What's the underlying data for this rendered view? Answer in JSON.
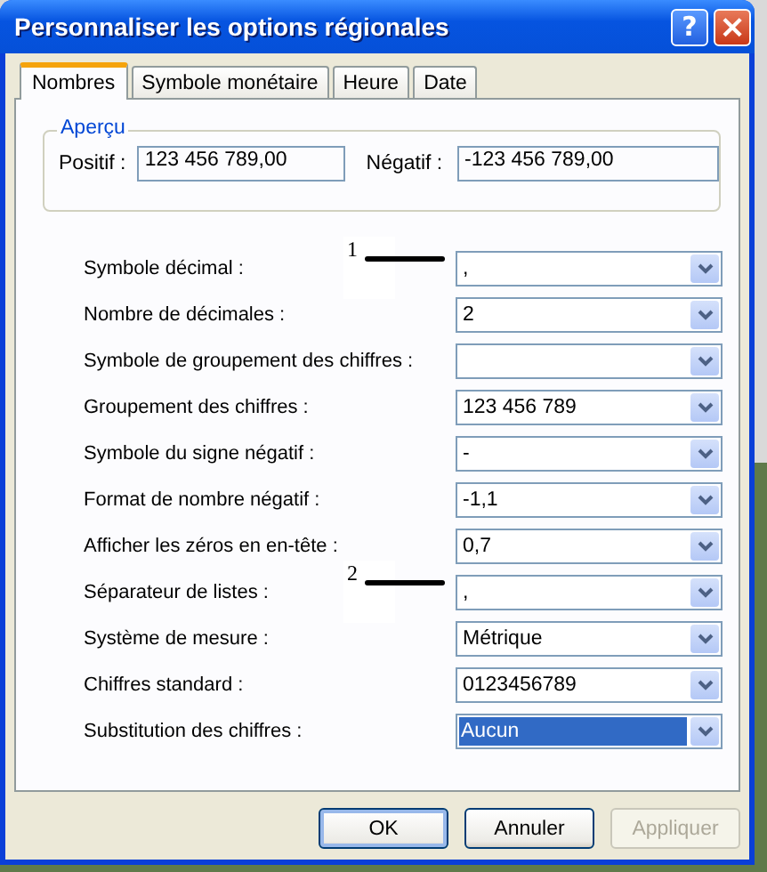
{
  "window": {
    "title": "Personnaliser les options régionales",
    "help": "?",
    "close": "×"
  },
  "tabs": [
    {
      "label": "Nombres",
      "selected": true
    },
    {
      "label": "Symbole monétaire",
      "selected": false
    },
    {
      "label": "Heure",
      "selected": false
    },
    {
      "label": "Date",
      "selected": false
    }
  ],
  "preview": {
    "title": "Aperçu",
    "positive_label": "Positif :",
    "positive_value": "123 456 789,00",
    "negative_label": "Négatif :",
    "negative_value": "-123 456 789,00"
  },
  "settings": [
    {
      "label": "Symbole décimal :",
      "value": ",",
      "focused": false,
      "annotation": "1"
    },
    {
      "label": "Nombre de décimales :",
      "value": "2",
      "focused": false
    },
    {
      "label": "Symbole de groupement des chiffres :",
      "focused": false
    },
    {
      "label": "Groupement des chiffres :",
      "value": "123 456 789",
      "focused": false
    },
    {
      "label": "Symbole du signe négatif :",
      "value": "-",
      "focused": false
    },
    {
      "label": "Format de nombre négatif :",
      "value": "-1,1",
      "focused": false
    },
    {
      "label": "Afficher les zéros en en-tête :",
      "value": "0,7",
      "focused": false
    },
    {
      "label": "Séparateur de listes :",
      "value": ",",
      "focused": false,
      "annotation": "2"
    },
    {
      "label": "Système de mesure :",
      "value": "Métrique",
      "focused": false
    },
    {
      "label": "Chiffres standard :",
      "value": "0123456789",
      "focused": false
    },
    {
      "label": "Substitution des chiffres :",
      "value": "Aucun",
      "focused": true
    }
  ],
  "buttons": [
    {
      "label": "OK",
      "default": true,
      "disabled": false
    },
    {
      "label": "Annuler",
      "default": false,
      "disabled": false
    },
    {
      "label": "Appliquer",
      "default": false,
      "disabled": true
    }
  ]
}
